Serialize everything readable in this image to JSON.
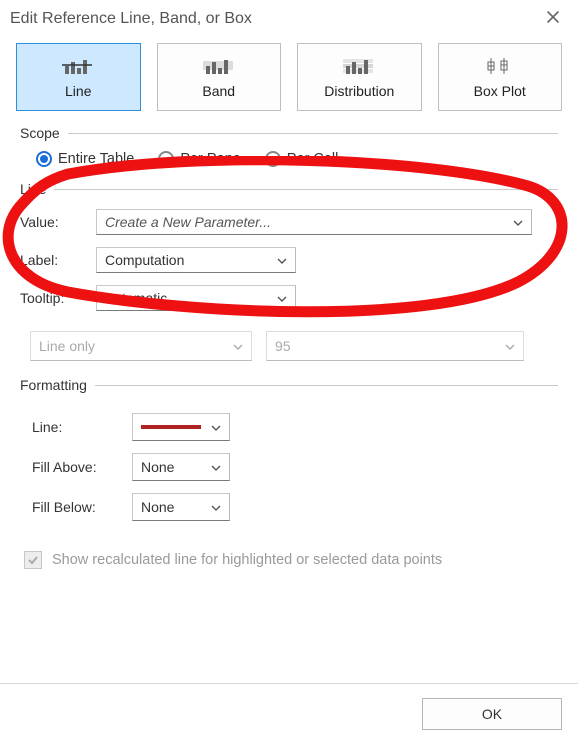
{
  "title": "Edit Reference Line, Band, or Box",
  "tabs": {
    "line": "Line",
    "band": "Band",
    "dist": "Distribution",
    "box": "Box Plot"
  },
  "scope": {
    "legend": "Scope",
    "entire": "Entire Table",
    "pane": "Per Pane",
    "cell": "Per Cell"
  },
  "line": {
    "legend": "Line",
    "value_label": "Value:",
    "value_selected": "Create a New Parameter...",
    "label_label": "Label:",
    "label_selected": "Computation",
    "tooltip_label": "Tooltip:",
    "tooltip_selected": "Automatic",
    "mode": "Line only",
    "confidence": "95"
  },
  "formatting": {
    "legend": "Formatting",
    "line_label": "Line:",
    "fill_above_label": "Fill Above:",
    "fill_above_value": "None",
    "fill_below_label": "Fill Below:",
    "fill_below_value": "None"
  },
  "recalc_label": "Show recalculated line for highlighted or selected data points",
  "ok": "OK"
}
